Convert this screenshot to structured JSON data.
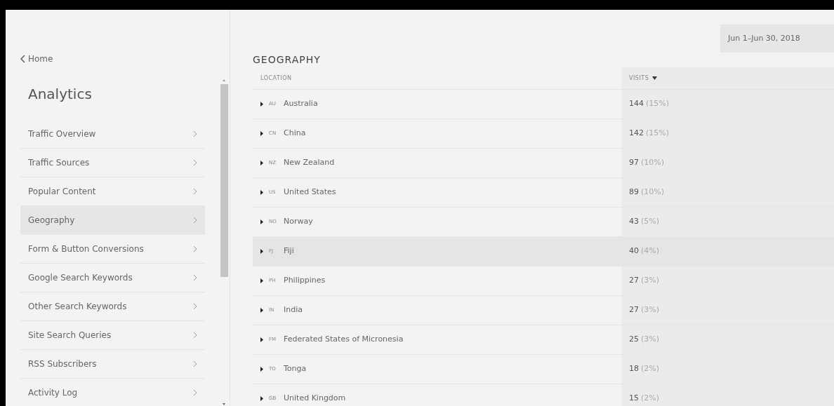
{
  "sidebar": {
    "back_link": "Home",
    "title": "Analytics",
    "items": [
      {
        "label": "Traffic Overview",
        "selected": false
      },
      {
        "label": "Traffic Sources",
        "selected": false
      },
      {
        "label": "Popular Content",
        "selected": false
      },
      {
        "label": "Geography",
        "selected": true
      },
      {
        "label": "Form & Button Conversions",
        "selected": false
      },
      {
        "label": "Google Search Keywords",
        "selected": false
      },
      {
        "label": "Other Search Keywords",
        "selected": false
      },
      {
        "label": "Site Search Queries",
        "selected": false
      },
      {
        "label": "RSS Subscribers",
        "selected": false
      },
      {
        "label": "Activity Log",
        "selected": false
      }
    ]
  },
  "main": {
    "title": "GEOGRAPHY",
    "date_range": "Jun 1–Jun 30, 2018",
    "table": {
      "columns": [
        "LOCATION",
        "VISITS"
      ],
      "rows": [
        {
          "code": "AU",
          "location": "Australia",
          "visits": "144",
          "share": "(15%)",
          "selected": false
        },
        {
          "code": "CN",
          "location": "China",
          "visits": "142",
          "share": "(15%)",
          "selected": false
        },
        {
          "code": "NZ",
          "location": "New Zealand",
          "visits": "97",
          "share": "(10%)",
          "selected": false
        },
        {
          "code": "US",
          "location": "United States",
          "visits": "89",
          "share": "(10%)",
          "selected": false
        },
        {
          "code": "NO",
          "location": "Norway",
          "visits": "43",
          "share": "(5%)",
          "selected": false
        },
        {
          "code": "FJ",
          "location": "Fiji",
          "visits": "40",
          "share": "(4%)",
          "selected": true
        },
        {
          "code": "PH",
          "location": "Philippines",
          "visits": "27",
          "share": "(3%)",
          "selected": false
        },
        {
          "code": "IN",
          "location": "India",
          "visits": "27",
          "share": "(3%)",
          "selected": false
        },
        {
          "code": "FM",
          "location": "Federated States of Micronesia",
          "visits": "25",
          "share": "(3%)",
          "selected": false
        },
        {
          "code": "TO",
          "location": "Tonga",
          "visits": "18",
          "share": "(2%)",
          "selected": false
        },
        {
          "code": "GB",
          "location": "United Kingdom",
          "visits": "15",
          "share": "(2%)",
          "selected": false
        }
      ]
    }
  }
}
